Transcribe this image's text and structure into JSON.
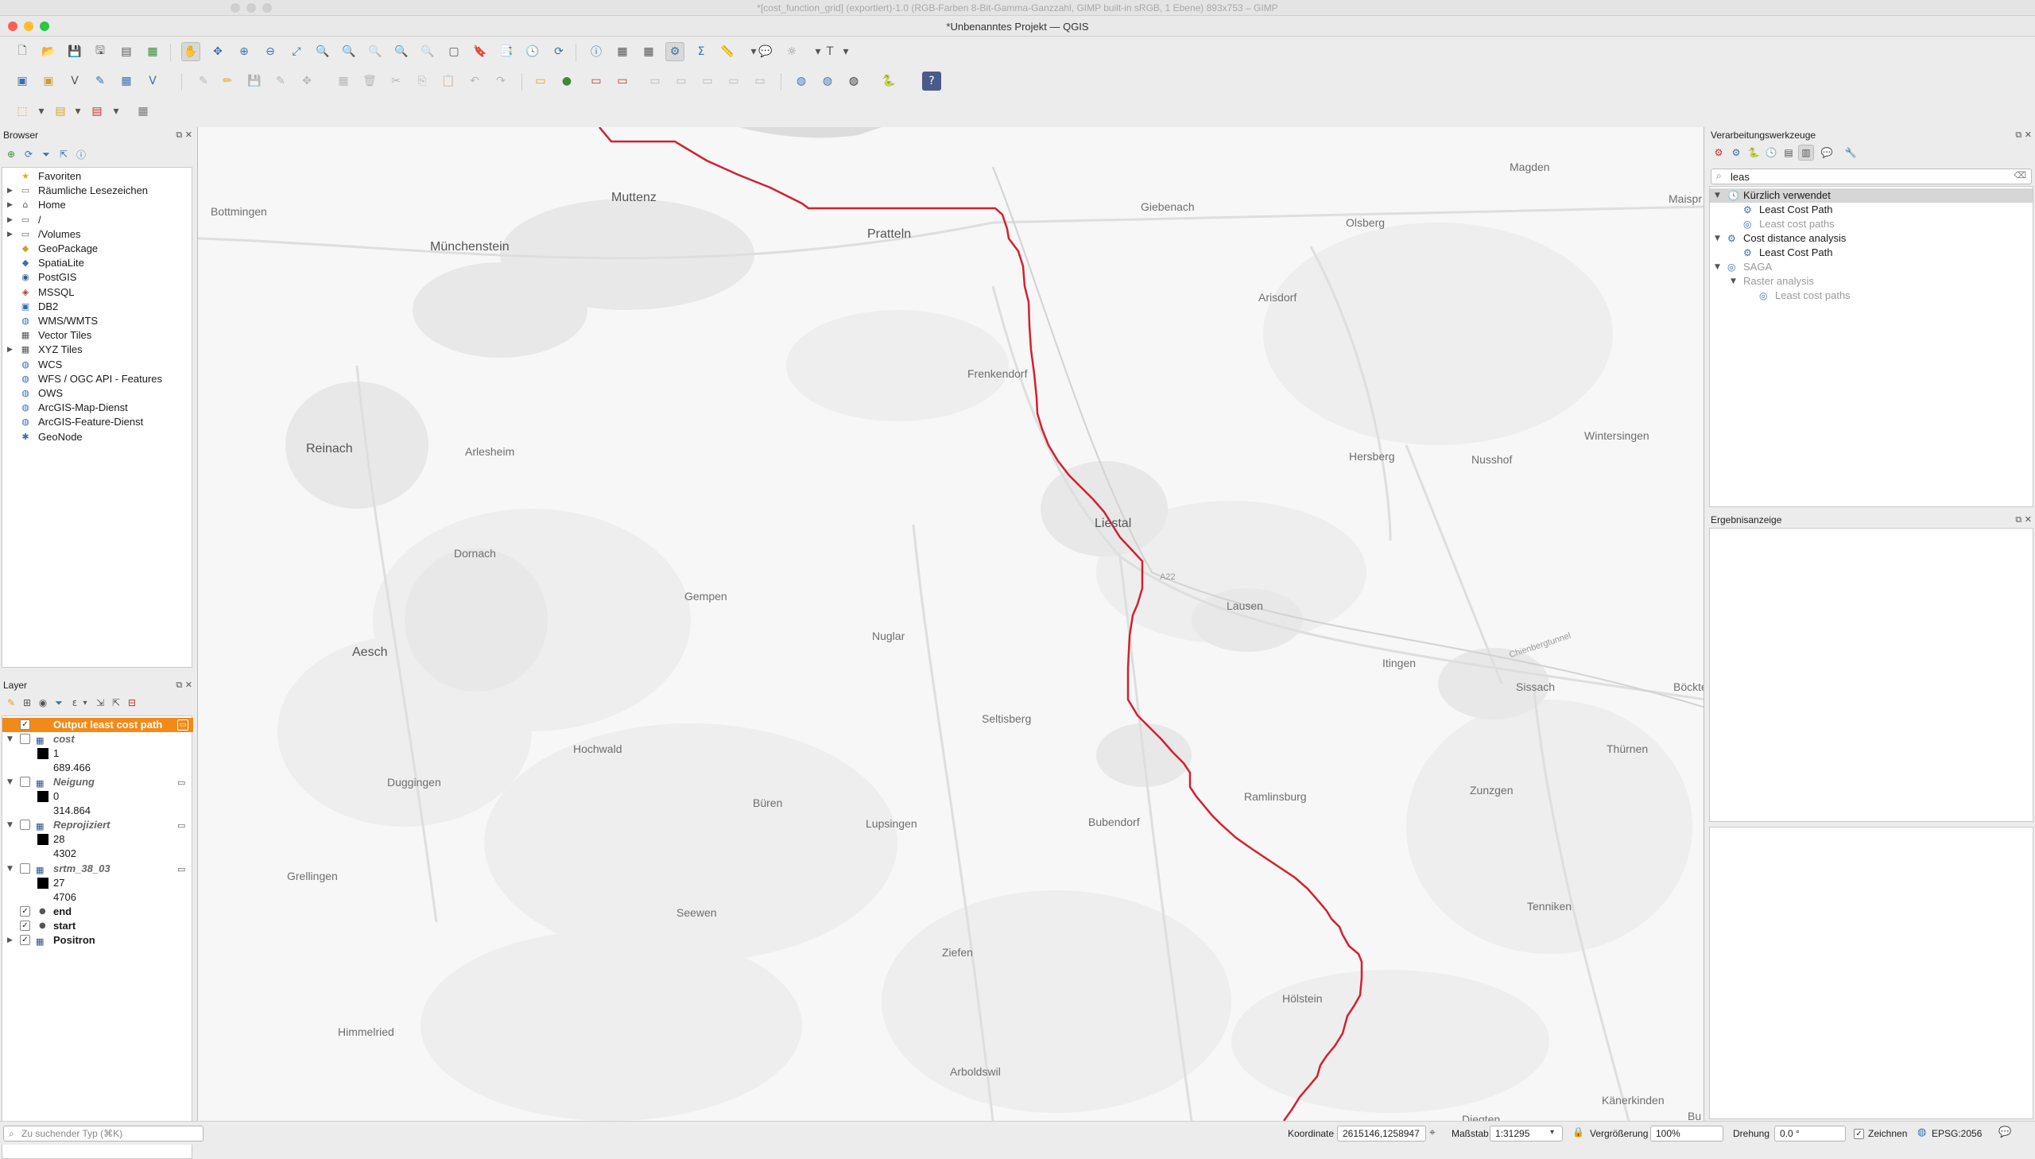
{
  "windows": {
    "gimp_title": "*[cost_function_grid] (exportiert)-1.0 (RGB-Farben 8-Bit-Gamma-Ganzzahl, GIMP built-in sRGB, 1 Ebene) 893x753 – GIMP",
    "qgis_title": "*Unbenanntes Projekt — QGIS"
  },
  "browser": {
    "title": "Browser",
    "items": [
      {
        "label": "Favoriten",
        "icon": "star-icon",
        "arrow": ""
      },
      {
        "label": "Räumliche Lesezeichen",
        "icon": "bookmark-icon",
        "arrow": "▶"
      },
      {
        "label": "Home",
        "icon": "home-folder-icon",
        "arrow": "▶"
      },
      {
        "label": "/",
        "icon": "folder-icon",
        "arrow": "▶"
      },
      {
        "label": "/Volumes",
        "icon": "folder-icon",
        "arrow": "▶"
      },
      {
        "label": "GeoPackage",
        "icon": "geopackage-icon",
        "arrow": ""
      },
      {
        "label": "SpatiaLite",
        "icon": "spatialite-icon",
        "arrow": ""
      },
      {
        "label": "PostGIS",
        "icon": "postgis-icon",
        "arrow": ""
      },
      {
        "label": "MSSQL",
        "icon": "mssql-icon",
        "arrow": ""
      },
      {
        "label": "DB2",
        "icon": "db2-icon",
        "arrow": ""
      },
      {
        "label": "WMS/WMTS",
        "icon": "globe-icon",
        "arrow": ""
      },
      {
        "label": "Vector Tiles",
        "icon": "grid-icon",
        "arrow": ""
      },
      {
        "label": "XYZ Tiles",
        "icon": "grid-icon",
        "arrow": "▶"
      },
      {
        "label": "WCS",
        "icon": "globe-icon",
        "arrow": ""
      },
      {
        "label": "WFS / OGC API - Features",
        "icon": "globe-icon",
        "arrow": ""
      },
      {
        "label": "OWS",
        "icon": "globe-icon",
        "arrow": ""
      },
      {
        "label": "ArcGIS-Map-Dienst",
        "icon": "arcgis-icon",
        "arrow": ""
      },
      {
        "label": "ArcGIS-Feature-Dienst",
        "icon": "arcgis-icon",
        "arrow": ""
      },
      {
        "label": "GeoNode",
        "icon": "geonode-icon",
        "arrow": ""
      }
    ]
  },
  "layers": {
    "title": "Layer",
    "rows": [
      {
        "label": "Output least cost path",
        "indent": 0,
        "type": "selected"
      },
      {
        "label": "cost",
        "indent": 0,
        "type": "raster",
        "arrow": "▼"
      },
      {
        "label": "1",
        "indent": 1,
        "type": "legend-swatch"
      },
      {
        "label": "689.466",
        "indent": 1,
        "type": "legend-value"
      },
      {
        "label": "Neigung",
        "indent": 0,
        "type": "raster",
        "arrow": "▼"
      },
      {
        "label": "0",
        "indent": 1,
        "type": "legend-swatch"
      },
      {
        "label": "314.864",
        "indent": 1,
        "type": "legend-value"
      },
      {
        "label": "Reprojiziert",
        "indent": 0,
        "type": "raster",
        "arrow": "▼"
      },
      {
        "label": "28",
        "indent": 1,
        "type": "legend-swatch"
      },
      {
        "label": "4302",
        "indent": 1,
        "type": "legend-value"
      },
      {
        "label": "srtm_38_03",
        "indent": 0,
        "type": "raster",
        "arrow": "▼"
      },
      {
        "label": "27",
        "indent": 1,
        "type": "legend-swatch"
      },
      {
        "label": "4706",
        "indent": 1,
        "type": "legend-value"
      },
      {
        "label": "end",
        "indent": 0,
        "type": "point"
      },
      {
        "label": "start",
        "indent": 0,
        "type": "point"
      },
      {
        "label": "Positron",
        "indent": 0,
        "type": "basemap"
      }
    ]
  },
  "processing": {
    "title": "Verarbeitungswerkzeuge",
    "search_value": "leas",
    "tree": [
      {
        "label": "Kürzlich verwendet",
        "level": 0,
        "icon": "clock-icon",
        "arrow": "▼",
        "dim": false,
        "selected": true
      },
      {
        "label": "Least Cost Path",
        "level": 1,
        "icon": "gear-icon",
        "arrow": "",
        "dim": false
      },
      {
        "label": "Least cost paths",
        "level": 1,
        "icon": "saga-icon",
        "arrow": "",
        "dim": true
      },
      {
        "label": "Cost distance analysis",
        "level": 0,
        "icon": "gear-icon",
        "arrow": "▼",
        "dim": false
      },
      {
        "label": "Least Cost Path",
        "level": 1,
        "icon": "gear-icon",
        "arrow": "",
        "dim": false
      },
      {
        "label": "SAGA",
        "level": 0,
        "icon": "saga-icon",
        "arrow": "▼",
        "dim": true
      },
      {
        "label": "Raster analysis",
        "level": 1,
        "icon": "",
        "arrow": "▼",
        "dim": true
      },
      {
        "label": "Least cost paths",
        "level": 2,
        "icon": "saga-icon",
        "arrow": "",
        "dim": true
      }
    ]
  },
  "results": {
    "title": "Ergebnisanzeige"
  },
  "map": {
    "places": [
      {
        "name": "Muttenz",
        "size": "big"
      },
      {
        "name": "Pratteln",
        "size": "big"
      },
      {
        "name": "Münchenstein",
        "size": "big"
      },
      {
        "name": "Bottmingen",
        "size": "small"
      },
      {
        "name": "Giebenach",
        "size": "small"
      },
      {
        "name": "Magden",
        "size": "small"
      },
      {
        "name": "Maispr",
        "size": "small"
      },
      {
        "name": "Olsberg",
        "size": "small"
      },
      {
        "name": "Arisdorf",
        "size": "small"
      },
      {
        "name": "Frenkendorf",
        "size": "small"
      },
      {
        "name": "Reinach",
        "size": "big"
      },
      {
        "name": "Arlesheim",
        "size": "small"
      },
      {
        "name": "Hersberg",
        "size": "small"
      },
      {
        "name": "Nusshof",
        "size": "small"
      },
      {
        "name": "Wintersingen",
        "size": "small"
      },
      {
        "name": "Liestal",
        "size": "big"
      },
      {
        "name": "Dornach",
        "size": "small"
      },
      {
        "name": "Gempen",
        "size": "small"
      },
      {
        "name": "Lausen",
        "size": "small"
      },
      {
        "name": "Nuglar",
        "size": "small"
      },
      {
        "name": "Aesch",
        "size": "big"
      },
      {
        "name": "Itingen",
        "size": "small"
      },
      {
        "name": "Sissach",
        "size": "small"
      },
      {
        "name": "Böckten",
        "size": "small"
      },
      {
        "name": "Seltisberg",
        "size": "small"
      },
      {
        "name": "Hochwald",
        "size": "small"
      },
      {
        "name": "Thürnen",
        "size": "small"
      },
      {
        "name": "Duggingen",
        "size": "small"
      },
      {
        "name": "Ramlinsburg",
        "size": "small"
      },
      {
        "name": "Zunzgen",
        "size": "small"
      },
      {
        "name": "Büren",
        "size": "small"
      },
      {
        "name": "Lupsingen",
        "size": "small"
      },
      {
        "name": "Bubendorf",
        "size": "small"
      },
      {
        "name": "Grellingen",
        "size": "small"
      },
      {
        "name": "Tenniken",
        "size": "small"
      },
      {
        "name": "Seewen",
        "size": "small"
      },
      {
        "name": "Ziefen",
        "size": "small"
      },
      {
        "name": "Hölstein",
        "size": "small"
      },
      {
        "name": "Himmelried",
        "size": "small"
      },
      {
        "name": "Arboldswil",
        "size": "small"
      },
      {
        "name": "Känerkinden",
        "size": "small"
      },
      {
        "name": "Diegten",
        "size": "small"
      },
      {
        "name": "Bu",
        "size": "small"
      },
      {
        "name": "A22",
        "size": "tiny"
      },
      {
        "name": "Chienbergtunnel",
        "size": "tiny"
      }
    ]
  },
  "statusbar": {
    "search_placeholder": "Zu suchender Typ (⌘K)",
    "coord_label": "Koordinate",
    "coord_value": "2615146,1258947",
    "scale_label": "Maßstab",
    "scale_value": "1:31295",
    "magnifier_label": "Vergrößerung",
    "magnifier_value": "100%",
    "rotation_label": "Drehung",
    "rotation_value": "0.0 °",
    "render_label": "Zeichnen",
    "crs_label": "EPSG:2056"
  },
  "colors": {
    "path": "#d3202f",
    "selected_layer": "#f28a1a",
    "map_bg": "#f7f7f7"
  }
}
